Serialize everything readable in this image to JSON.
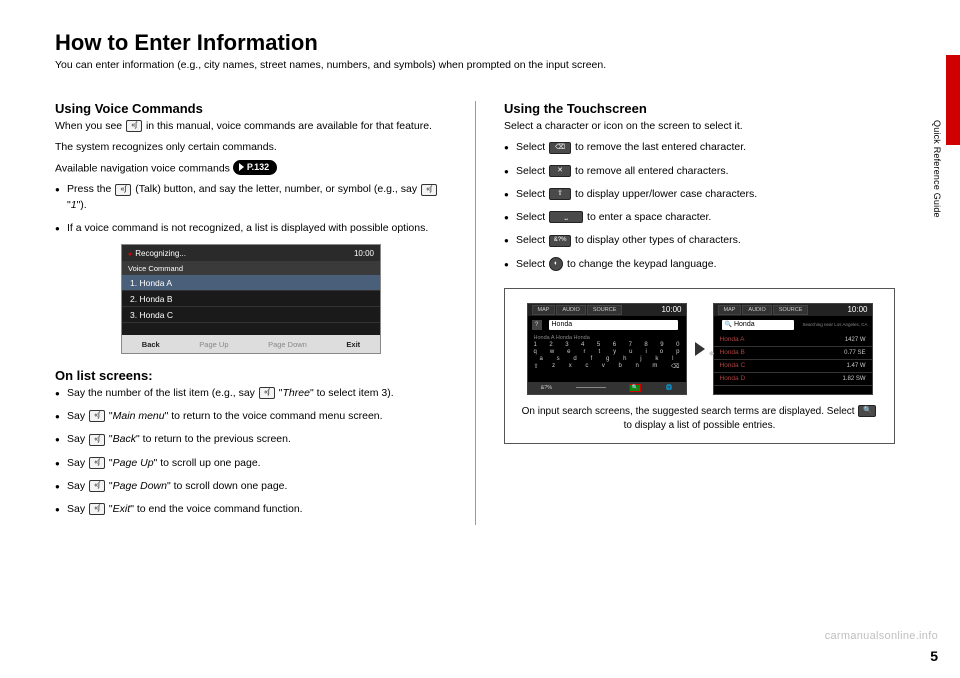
{
  "sideLabel": "Quick Reference Guide",
  "title": "How to Enter Information",
  "subtitle": "You can enter information (e.g., city names, street names, numbers, and symbols) when prompted on the input screen.",
  "voice": {
    "heading": "Using Voice Commands",
    "intro1": "When you see ",
    "intro2": " in this manual, voice commands are available for that feature.",
    "line2a": "The system recognizes only certain commands.",
    "line2b": "Available navigation voice commands ",
    "pref": "P.132",
    "b1a": "Press the ",
    "b1b": " (Talk) button, and say the letter, number, or symbol (e.g., say ",
    "b1c": " \"",
    "b1d": "1",
    "b1e": "\").",
    "b2": "If a voice command is not recognized, a list is displayed with possible options."
  },
  "vshot": {
    "recognizing": "Recognizing...",
    "time": "10:00",
    "header": "Voice Command",
    "r1": "1. Honda A",
    "r2": "2. Honda B",
    "r3": "3. Honda C",
    "back": "Back",
    "pu": "Page Up",
    "pd": "Page Down",
    "exit": "Exit"
  },
  "list": {
    "heading": "On list screens:",
    "i1a": "Say the number of the list item (e.g., say ",
    "i1b": " \"",
    "i1c": "Three",
    "i1d": "\" to select item 3).",
    "i2a": "Say ",
    "i2b": " \"",
    "i2c": "Main menu",
    "i2d": "\" to return to the voice command menu screen.",
    "i3a": "Say ",
    "i3b": " \"",
    "i3c": "Back",
    "i3d": "\" to return to the previous screen.",
    "i4a": "Say ",
    "i4b": " \"",
    "i4c": "Page Up",
    "i4d": "\" to scroll up one page.",
    "i5a": "Say ",
    "i5b": " \"",
    "i5c": "Page Down",
    "i5d": "\" to scroll down one page.",
    "i6a": "Say ",
    "i6b": " \"",
    "i6c": "Exit",
    "i6d": "\" to end the voice command function."
  },
  "touch": {
    "heading": "Using the Touchscreen",
    "intro": "Select a character or icon on the screen to select it.",
    "i1a": "Select ",
    "i1b": " to remove the last entered character.",
    "i2a": "Select ",
    "i2b": " to remove all entered characters.",
    "i3a": "Select ",
    "i3b": " to display upper/lower case characters.",
    "i4a": "Select ",
    "i4b": " to enter a space character.",
    "i5a": "Select ",
    "i5b": " to display other types of characters.",
    "i6a": "Select ",
    "i6b": " to change the keypad language.",
    "caption1": "On input search screens, the suggested search terms are displayed. Select ",
    "caption2": " to display a list of possible entries."
  },
  "ms1": {
    "tabs": [
      "MAP",
      "AUDIO",
      "SOURCE"
    ],
    "time": "10:00",
    "search": "Honda",
    "sugg": "Honda A   Honda   Honda",
    "rowN": [
      "1",
      "2",
      "3",
      "4",
      "5",
      "6",
      "7",
      "8",
      "9",
      "0"
    ],
    "rowQ": [
      "q",
      "w",
      "e",
      "r",
      "t",
      "y",
      "u",
      "i",
      "o",
      "p"
    ],
    "rowA": [
      "a",
      "s",
      "d",
      "f",
      "g",
      "h",
      "j",
      "k",
      "l"
    ],
    "rowZ": [
      "⇧",
      "z",
      "x",
      "c",
      "v",
      "b",
      "n",
      "m",
      "⌫"
    ],
    "bottom": [
      "&?%",
      "",
      "🌐"
    ]
  },
  "ms2": {
    "tabs": [
      "MAP",
      "AUDIO",
      "SOURCE"
    ],
    "time": "10:00",
    "search": "Honda",
    "loc": "Searching near Los Angeles, CA",
    "rows": [
      {
        "name": "Honda A",
        "dist": "1427 W"
      },
      {
        "name": "Honda B",
        "dist": "0.77 SE"
      },
      {
        "name": "Honda C",
        "dist": "1.47 W"
      },
      {
        "name": "Honda D",
        "dist": "1.82 SW"
      }
    ]
  },
  "watermark": "carmanualsonline.info",
  "pageNum": "5",
  "icons": {
    "talk": "𝄞",
    "delete": "⌫",
    "clear": "✕",
    "shift": "⇧",
    "space": " ",
    "sym": "&?%",
    "globe": "◐",
    "searchMag": "🔍"
  }
}
